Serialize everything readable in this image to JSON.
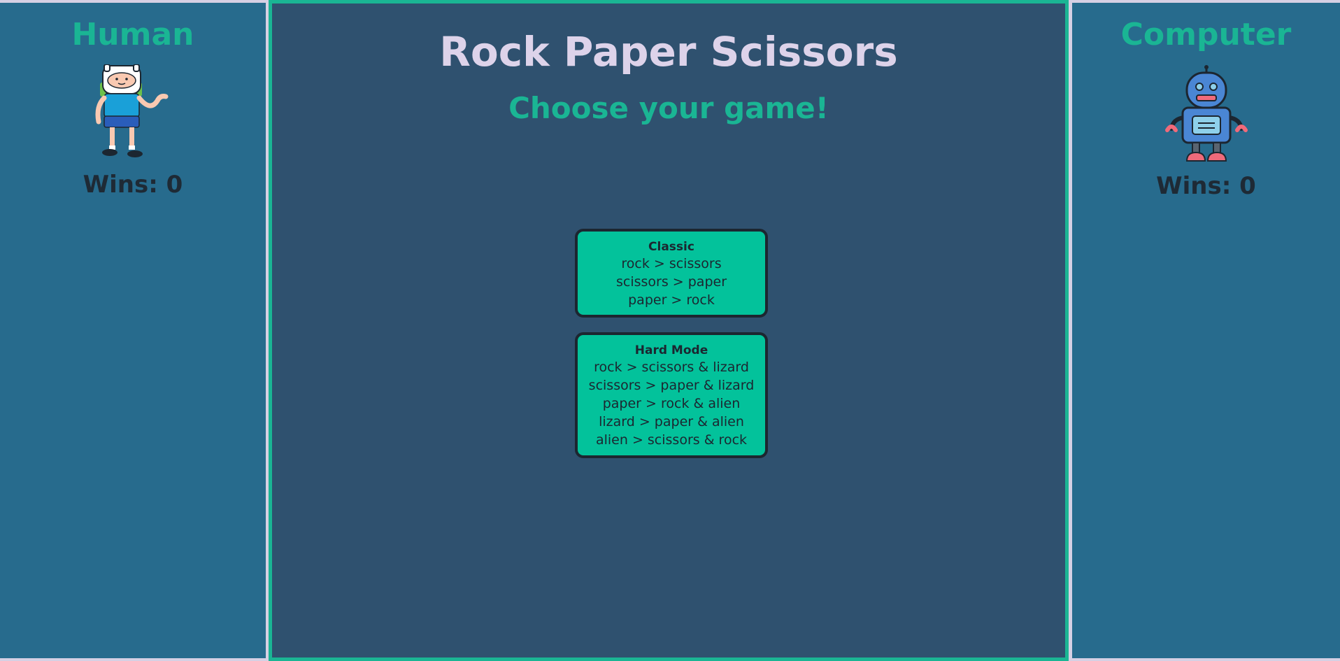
{
  "game": {
    "title": "Rock Paper Scissors",
    "subtitle": "Choose your game!"
  },
  "human": {
    "label": "Human",
    "wins_text": "Wins: 0",
    "avatar_icon": "finn-human-character-icon"
  },
  "computer": {
    "label": "Computer",
    "wins_text": "Wins: 0",
    "avatar_icon": "robot-icon"
  },
  "modes": {
    "classic": {
      "name": "Classic",
      "rules": [
        "rock > scissors",
        "scissors > paper",
        "paper > rock"
      ]
    },
    "hard": {
      "name": "Hard Mode",
      "rules": [
        "rock > scissors & lizard",
        "scissors > paper & lizard",
        "paper > rock & alien",
        "lizard > paper & alien",
        "alien > scissors & rock"
      ]
    }
  },
  "colors": {
    "accent": "#1ab594",
    "sidebar": "#276b8d",
    "main": "#2f516f",
    "card": "#03c29b",
    "title": "#ddd3ea",
    "dark_text": "#1e2a35"
  }
}
